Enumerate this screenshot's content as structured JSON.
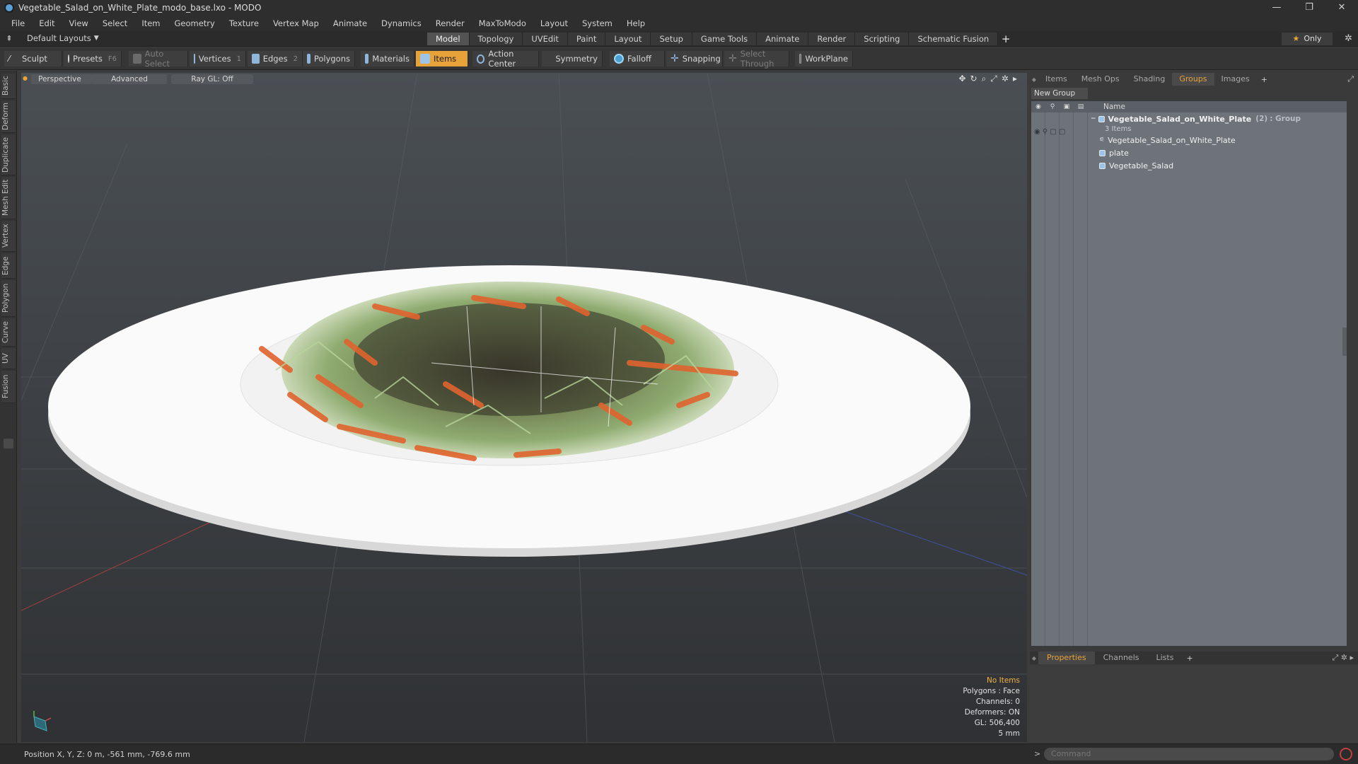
{
  "window": {
    "title": "Vegetable_Salad_on_White_Plate_modo_base.lxo - MODO",
    "controls": [
      "—",
      "❐",
      "✕"
    ]
  },
  "menu": [
    "File",
    "Edit",
    "View",
    "Select",
    "Item",
    "Geometry",
    "Texture",
    "Vertex Map",
    "Animate",
    "Dynamics",
    "Render",
    "MaxToModo",
    "Layout",
    "System",
    "Help"
  ],
  "modebar": {
    "layout_label": "Default Layouts",
    "tabs": [
      "Model",
      "Topology",
      "UVEdit",
      "Paint",
      "Layout",
      "Setup",
      "Game Tools",
      "Animate",
      "Render",
      "Scripting",
      "Schematic Fusion"
    ],
    "active_tab": "Model",
    "only_label": "Only"
  },
  "toolbar": {
    "sculpt": "Sculpt",
    "presets": "Presets",
    "presets_key": "F6",
    "auto_select": "Auto Select",
    "vertices": "Vertices",
    "vertices_key": "1",
    "edges": "Edges",
    "edges_key": "2",
    "polygons": "Polygons",
    "materials": "Materials",
    "items": "Items",
    "action_center": "Action Center",
    "symmetry": "Symmetry",
    "falloff": "Falloff",
    "snapping": "Snapping",
    "select_through": "Select Through",
    "workplane": "WorkPlane"
  },
  "left_tabs": [
    "Basic",
    "Deform",
    "Duplicate",
    "Mesh Edit",
    "Vertex",
    "Edge",
    "Polygon",
    "Curve",
    "UV",
    "Fusion"
  ],
  "viewport": {
    "view_mode": "Perspective",
    "shading": "Advanced",
    "raygl": "Ray GL: Off",
    "info": {
      "selection": "No Items",
      "polygons": "Polygons : Face",
      "channels": "Channels: 0",
      "deformers": "Deformers: ON",
      "gl": "GL: 506,400",
      "grid": "5 mm"
    }
  },
  "right_panel": {
    "tabs": [
      "Items",
      "Mesh Ops",
      "Shading",
      "Groups",
      "Images"
    ],
    "active_tab": "Groups",
    "new_group": "New Group",
    "column_name": "Name",
    "tree": {
      "group_name": "Vegetable_Salad_on_White_Plate",
      "group_count": "(2)",
      "group_type": ": Group",
      "items_label": "3 Items",
      "children": [
        "Vegetable_Salad_on_White_Plate",
        "plate",
        "Vegetable_Salad"
      ]
    }
  },
  "properties": {
    "tabs": [
      "Properties",
      "Channels",
      "Lists"
    ],
    "active_tab": "Properties"
  },
  "status": {
    "position": "Position X, Y, Z:  0 m, -561 mm, -769.6 mm",
    "command_placeholder": "Command"
  },
  "colors": {
    "accent": "#e8a23a",
    "background": "#3c3c3c",
    "viewport_top": "#4a4f54",
    "tree_bg": "#6d7378"
  }
}
